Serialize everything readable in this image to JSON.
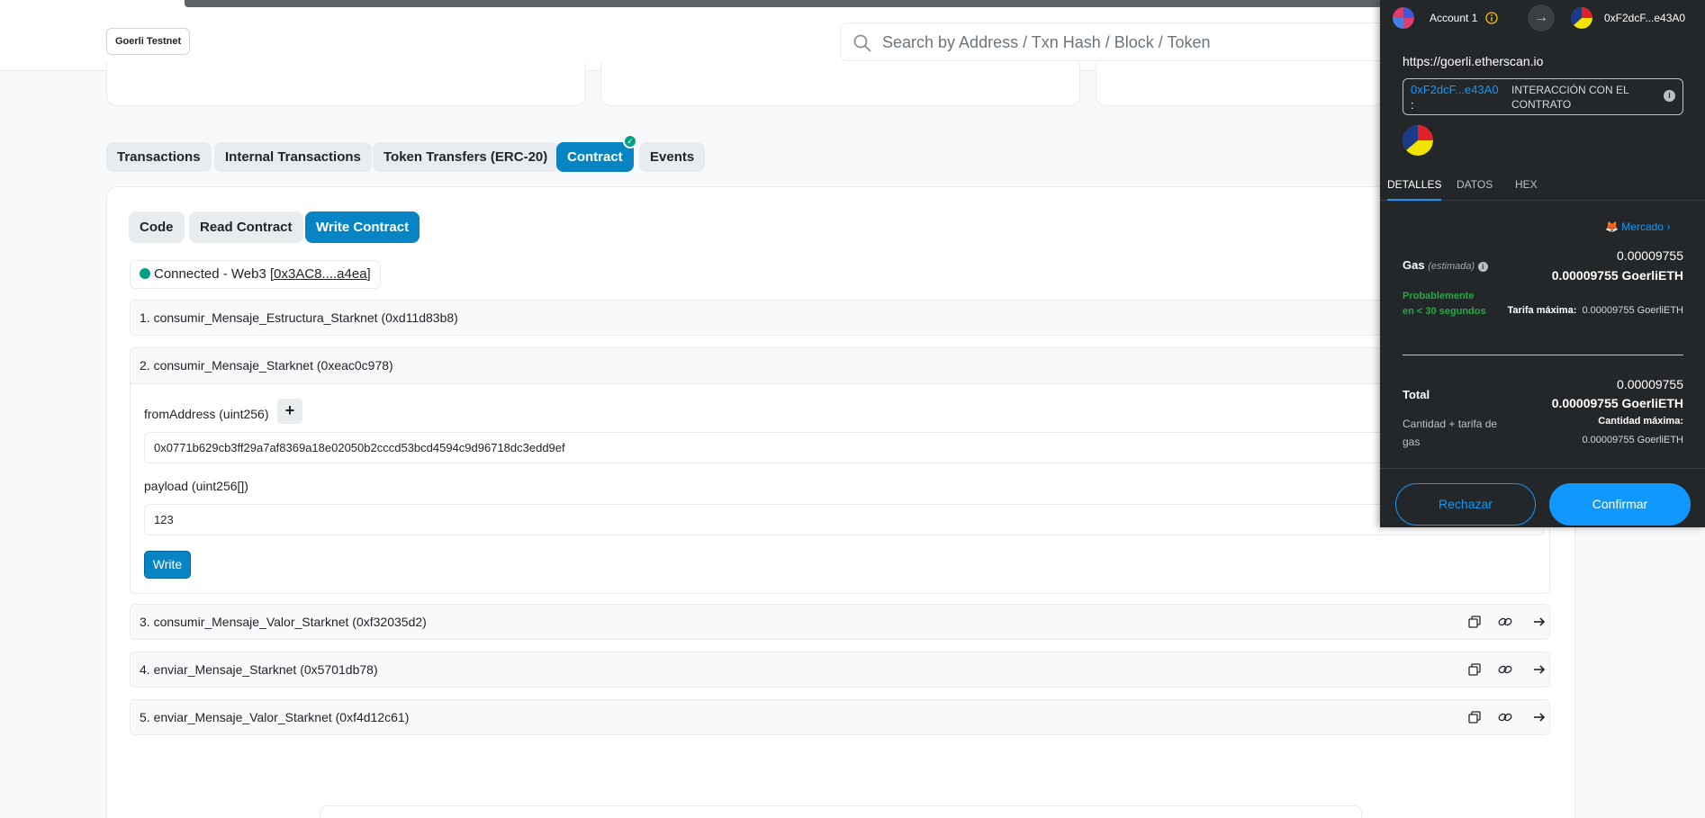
{
  "header": {
    "network": "Goerli Testnet",
    "search_placeholder": "Search by Address / Txn Hash / Block / Token"
  },
  "tabs": [
    {
      "label": "Transactions"
    },
    {
      "label": "Internal Transactions"
    },
    {
      "label": "Token Transfers (ERC-20)"
    },
    {
      "label": "Contract"
    },
    {
      "label": "Events"
    }
  ],
  "subtabs": [
    {
      "label": "Code"
    },
    {
      "label": "Read Contract"
    },
    {
      "label": "Write Contract"
    }
  ],
  "connection": {
    "prefix": "Connected - Web3 [",
    "address": "0x3AC8....a4ea",
    "suffix": "]"
  },
  "functions": [
    {
      "label": "1. consumir_Mensaje_Estructura_Starknet (0xd11d83b8)"
    },
    {
      "label": "2. consumir_Mensaje_Starknet (0xeac0c978)"
    },
    {
      "label": "3. consumir_Mensaje_Valor_Starknet (0xf32035d2)"
    },
    {
      "label": "4. enviar_Mensaje_Starknet (0x5701db78)"
    },
    {
      "label": "5. enviar_Mensaje_Valor_Starknet (0xf4d12c61)"
    }
  ],
  "expanded": {
    "from_label": "fromAddress (uint256)",
    "from_value": "0x0771b629cb3ff29a7af8369a18e02050b2cccd53bcd4594c9d96718dc3edd9ef",
    "payload_label": "payload (uint256[])",
    "payload_value": "123",
    "plus": "+",
    "write_label": "Write"
  },
  "metamask": {
    "account": "Account 1",
    "to_address": "0xF2dcF...e43A0",
    "origin": "https://goerli.etherscan.io",
    "contract_address": "0xF2dcF...e43A0",
    "contract_colon": ":",
    "interaction": "INTERACCIÓN CON EL CONTRATO",
    "tabs": [
      {
        "label": "DETALLES"
      },
      {
        "label": "DATOS"
      },
      {
        "label": "HEX"
      }
    ],
    "market": "Mercado",
    "gas_label": "Gas",
    "gas_estimated": "(estimada)",
    "gas_value": "0.00009755",
    "gas_value_eth": "0.00009755 GoerliETH",
    "likely": "Probablemente en < 30 segundos",
    "max_fee_label": "Tarifa máxima:",
    "max_fee_value": "0.00009755 GoerliETH",
    "total_label": "Total",
    "total_value": "0.00009755",
    "total_value_eth": "0.00009755 GoerliETH",
    "qty_label": "Cantidad + tarifa de gas",
    "qty_max_label": "Cantidad máxima:",
    "qty_max_value": "0.00009755 GoerliETH",
    "reject": "Rechazar",
    "confirm": "Confirmar"
  },
  "colors": {
    "accent": "#0784c3",
    "success": "#00a186",
    "metamask_bg": "#24272a",
    "metamask_blue": "#1098fc"
  }
}
